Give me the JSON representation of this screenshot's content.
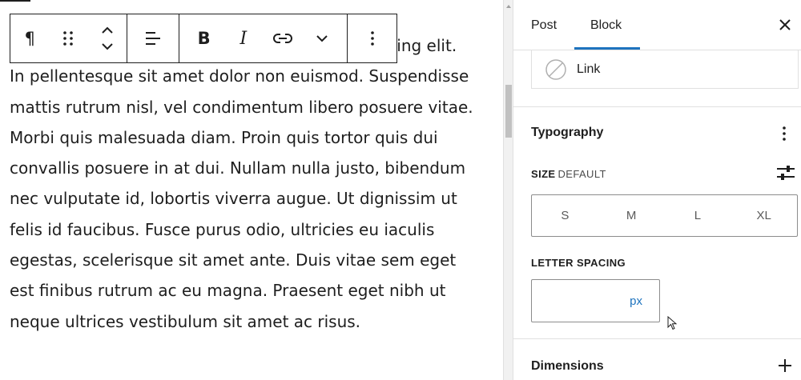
{
  "editor": {
    "paragraph_text": "Lorem ipsum dolor sit amet, consectetur adipiscing elit. In pellentesque sit amet dolor non euismod. Suspendisse mattis rutrum nisl, vel condimentum libero posuere vitae. Morbi quis malesuada diam. Proin quis tortor quis dui convallis posuere in at dui. Nullam nulla justo, bibendum nec vulputate id, lobortis viverra augue. Ut dignissim ut felis id faucibus. Fusce purus odio, ultricies eu iaculis egestas, scelerisque sit amet ante. Duis vitae sem eget est finibus rutrum ac eu magna. Praesent eget nibh ut neque ultrices vestibulum sit amet ac risus."
  },
  "toolbar": {
    "paragraph_icon": "¶",
    "bold_label": "B",
    "italic_label": "I",
    "icons": [
      "paragraph-icon",
      "drag-handle-icon",
      "move-up-icon",
      "move-down-icon",
      "align-left-icon",
      "bold-icon",
      "italic-icon",
      "link-icon",
      "chevron-down-icon",
      "more-options-icon"
    ]
  },
  "sidebar": {
    "tabs": [
      {
        "label": "Post",
        "active": false
      },
      {
        "label": "Block",
        "active": true
      }
    ],
    "link_label": "Link",
    "typography": {
      "title": "Typography",
      "size_label": "SIZE",
      "size_value": "DEFAULT",
      "size_options": [
        "S",
        "M",
        "L",
        "XL"
      ],
      "letter_spacing_label": "LETTER SPACING",
      "letter_spacing_value": "",
      "letter_spacing_unit": "px"
    },
    "dimensions_title": "Dimensions"
  },
  "colors": {
    "accent": "#1e73be",
    "text": "#1e1e1e",
    "border": "#e0e0e0"
  }
}
